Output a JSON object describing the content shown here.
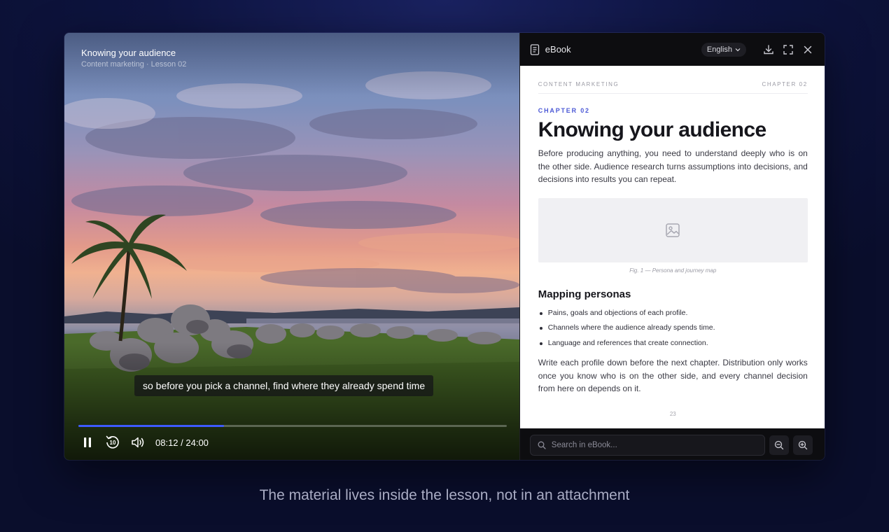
{
  "video": {
    "title": "Knowing your audience",
    "subtitle": "Content marketing · Lesson 02",
    "caption": "so before you pick a channel, find where they already spend time",
    "progress": 0.34,
    "time": "08:12 / 24:00",
    "icons": [
      "pause-icon",
      "replay-10-icon",
      "volume-icon"
    ]
  },
  "ebook": {
    "title": "eBook",
    "language": "English",
    "running_left": "CONTENT MARKETING",
    "running_right": "CHAPTER 02",
    "chapter_label": "CHAPTER 02",
    "heading": "Knowing your audience",
    "intro": "Before producing anything, you need to understand deeply who is on the other side. Audience research turns assumptions into decisions, and decisions into results you can repeat.",
    "figure_caption": "Fig. 1 — Persona and journey map",
    "section_heading": "Mapping personas",
    "bullets": [
      "Pains, goals and objections of each profile.",
      "Channels where the audience already spends time.",
      "Language and references that create connection."
    ],
    "outro": "Write each profile down before the next chapter. Distribution only works once you know who is on the other side, and every channel decision from here on depends on it.",
    "page_number": "23",
    "search_placeholder": "Search in eBook..."
  },
  "tagline": "The material lives inside the lesson, not in an attachment",
  "colors": {
    "accent": "#3d5afe",
    "chapter": "#4b58d6"
  }
}
